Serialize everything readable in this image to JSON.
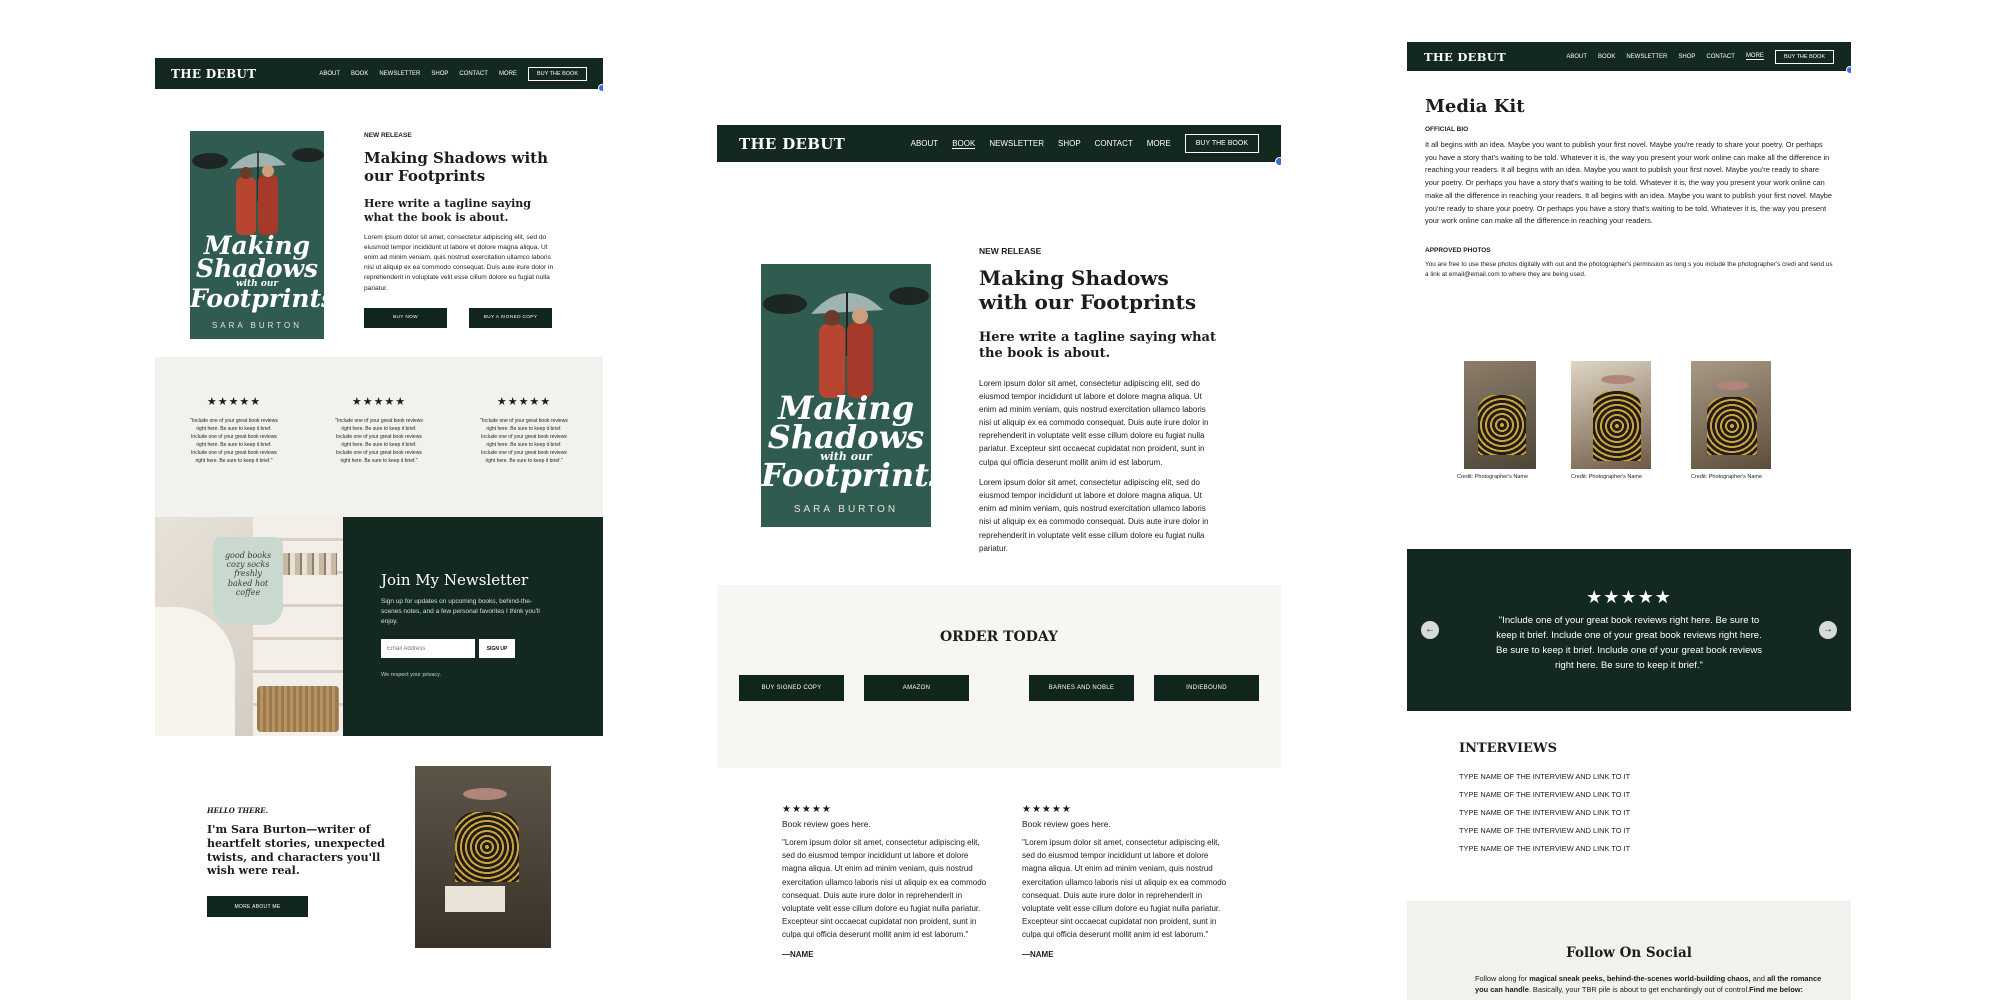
{
  "site": {
    "logo": "THE DEBUT",
    "nav": [
      "ABOUT",
      "BOOK",
      "NEWSLETTER",
      "SHOP",
      "CONTACT",
      "MORE"
    ],
    "buy_button": "BUY THE BOOK"
  },
  "book": {
    "cover_title_1": "Making",
    "cover_title_2": "Shadows",
    "cover_title_3": "with our",
    "cover_title_4": "Footprints",
    "cover_author": "SARA BURTON"
  },
  "home": {
    "kicker": "NEW RELEASE",
    "heading": "Making Shadows with our Footprints",
    "tagline": "Here write a tagline saying what the book is about.",
    "body": "Lorem ipsum dolor sit amet, consectetur adipiscing elit, sed do eiusmod tempor incididunt ut labore et dolore magna aliqua. Ut enim ad minim veniam, quis nostrud exercitation ullamco laboris nisi ut aliquip ex ea commodo consequat. Duis aute irure dolor in reprehenderit in voluptate velit esse cillum dolore eu fugiat nulla pariatur.",
    "btn_buy_now": "BUY NOW",
    "btn_signed": "BUY A SIGNED COPY",
    "reviews": [
      {
        "stars": "★★★★★",
        "text": "\"Include one of your great book reviews right here. Be sure to keep it brief. Include one of your great book reviews right here. Be sure to keep it brief. Include one of your great book reviews right here. Be sure to keep it brief.\""
      },
      {
        "stars": "★★★★★",
        "text": "\"Include one of your great book reviews right here. Be sure to keep it brief. Include one of your great book reviews right here. Be sure to keep it brief. Include one of your great book reviews right here. Be sure to keep it brief.\""
      },
      {
        "stars": "★★★★★",
        "text": "\"Include one of your great book reviews right here. Be sure to keep it brief. Include one of your great book reviews right here. Be sure to keep it brief. Include one of your great book reviews right here. Be sure to keep it brief.\""
      }
    ],
    "newsletter_heading": "Join My Newsletter",
    "newsletter_body": "Sign up for updates on upcoming books, behind-the-scenes notes, and a few personal favorites I think you'll enjoy.",
    "email_placeholder": "Email Address",
    "signup": "SIGN UP",
    "privacy": "We respect your privacy.",
    "mug_text": "good books cozy socks freshly baked hot coffee",
    "hello": "HELLO THERE.",
    "intro": "I'm Sara Burton—writer of heartfelt stories, unexpected twists, and characters you'll wish were real.",
    "more_about": "MORE ABOUT ME"
  },
  "book_page": {
    "kicker": "NEW RELEASE",
    "heading": "Making Shadows with our Footprints",
    "tagline": "Here write a tagline saying what the book is about.",
    "body1": "Lorem ipsum dolor sit amet, consectetur adipiscing elit, sed do eiusmod tempor incididunt ut labore et dolore magna aliqua. Ut enim ad minim veniam, quis nostrud exercitation ullamco laboris nisi ut aliquip ex ea commodo consequat. Duis aute irure dolor in reprehenderit in voluptate velit esse cillum dolore eu fugiat nulla pariatur. Excepteur sint occaecat cupidatat non proident, sunt in culpa qui officia deserunt mollit anim id est laborum.",
    "body2": "Lorem ipsum dolor sit amet, consectetur adipiscing elit, sed do eiusmod tempor incididunt ut labore et dolore magna aliqua. Ut enim ad minim veniam, quis nostrud exercitation ullamco laboris nisi ut aliquip ex ea commodo consequat. Duis aute irure dolor in reprehenderit in voluptate velit esse cillum dolore eu fugiat nulla pariatur.",
    "order_heading": "ORDER TODAY",
    "order_buttons": [
      "BUY SIGNED COPY",
      "AMAZON",
      "BARNES AND NOBLE",
      "INDIEBOUND"
    ],
    "reviews": [
      {
        "stars": "★★★★★",
        "lead": "Book review goes here.",
        "text": "\"Lorem ipsum dolor sit amet, consectetur adipiscing elit, sed do eiusmod tempor incididunt ut labore et dolore magna aliqua. Ut enim ad minim veniam, quis nostrud exercitation ullamco laboris nisi ut aliquip ex ea commodo consequat. Duis aute irure dolor in reprehenderit in voluptate velit esse cillum dolore eu fugiat nulla pariatur. Excepteur sint occaecat cupidatat non proident, sunt in culpa qui officia deserunt mollit anim id est laborum.\"",
        "name": "—NAME"
      },
      {
        "stars": "★★★★★",
        "lead": "Book review goes here.",
        "text": "\"Lorem ipsum dolor sit amet, consectetur adipiscing elit, sed do eiusmod tempor incididunt ut labore et dolore magna aliqua. Ut enim ad minim veniam, quis nostrud exercitation ullamco laboris nisi ut aliquip ex ea commodo consequat. Duis aute irure dolor in reprehenderit in voluptate velit esse cillum dolore eu fugiat nulla pariatur. Excepteur sint occaecat cupidatat non proident, sunt in culpa qui officia deserunt mollit anim id est laborum.\"",
        "name": "—NAME"
      }
    ]
  },
  "media_kit": {
    "heading": "Media Kit",
    "bio_label": "OFFICIAL BIO",
    "bio": "It all begins with an idea. Maybe you want to publish your first novel. Maybe you're ready to share your poetry. Or perhaps you have a story that's waiting to be told. Whatever it is, the way you present your work online can make all the difference in reaching your readers. It all begins with an idea. Maybe you want to publish your first novel. Maybe you're ready to share your poetry. Or perhaps you have a story that's waiting to be told. Whatever it is, the way you present your work online can make all the difference in reaching your readers. It all begins with an idea. Maybe you want to publish your first novel. Maybe you're ready to share your poetry. Or perhaps you have a story that's waiting to be told. Whatever it is, the way you present your work online can make all the difference in reaching your readers.",
    "photos_label": "APPROVED PHOTOS",
    "photos_note": "You are free to use these photos digitally with out and the photographer's permission as long s you include the photographer's credi and send us a link at email@email.com to where they are being used.",
    "credits": [
      "Credit: Photographer's Name",
      "Credit: Photographer's Name",
      "Credit: Photographer's Name"
    ],
    "carousel_stars": "★★★★★",
    "carousel_quote": "\"Include one of your great book reviews right here. Be sure to keep it brief. Include one of your great book reviews right here. Be sure to keep it brief. Include one of your great book reviews right here. Be sure to keep it brief.\"",
    "interviews_heading": "INTERVIEWS",
    "interviews": [
      "TYPE NAME OF THE INTERVIEW AND LINK TO IT",
      "TYPE NAME OF THE INTERVIEW AND LINK TO IT",
      "TYPE NAME OF THE INTERVIEW AND LINK TO IT",
      "TYPE NAME OF THE INTERVIEW AND LINK TO IT",
      "TYPE NAME OF THE INTERVIEW AND LINK TO IT"
    ],
    "social_heading": "Follow On Social",
    "social_pre": "Follow along for ",
    "social_bold1": "magical sneak peeks, behind-the-scenes world-building chaos,",
    "social_mid": " and ",
    "social_bold2": "all the romance you can handle",
    "social_post": ". Basically, your TBR pile is about to get enchantingly out of control.",
    "social_bold3": "Find me below:"
  },
  "colors": {
    "brand_dark": "#13281f",
    "cover_teal": "#2f5b50",
    "cream": "#f2f1ed",
    "accent_red": "#b8452f"
  }
}
